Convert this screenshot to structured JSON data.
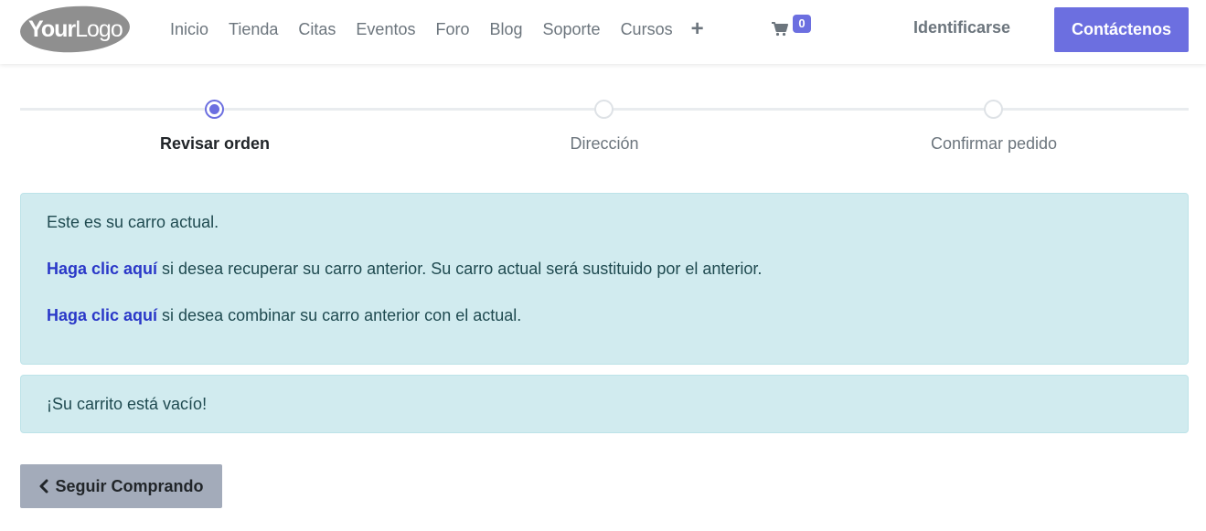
{
  "header": {
    "logo": {
      "word_bold": "Your",
      "word_thin": "Logo"
    },
    "nav": [
      "Inicio",
      "Tienda",
      "Citas",
      "Eventos",
      "Foro",
      "Blog",
      "Soporte",
      "Cursos"
    ],
    "plus_icon": "plus-icon",
    "cart": {
      "icon": "shopping-cart-icon",
      "count": "0"
    },
    "signin_label": "Identificarse",
    "contact_label": "Contáctenos"
  },
  "steps": [
    {
      "label": "Revisar orden",
      "active": true
    },
    {
      "label": "Dirección",
      "active": false
    },
    {
      "label": "Confirmar pedido",
      "active": false
    }
  ],
  "alert_cart": {
    "line1": "Este es su carro actual.",
    "restore_link": "Haga clic aquí",
    "restore_text": " si desea recuperar su carro anterior. Su carro actual será sustituido por el anterior.",
    "merge_link": "Haga clic aquí",
    "merge_text": " si desea combinar su carro anterior con el actual."
  },
  "alert_empty": {
    "text": "¡Su carrito está vacío!"
  },
  "continue_button": {
    "label": "Seguir Comprando",
    "icon": "chevron-left-icon"
  },
  "colors": {
    "accent": "#6c6fe0",
    "alert_bg": "#d1ebef",
    "link": "#2a38c8",
    "secondary_btn": "#a3abba"
  }
}
